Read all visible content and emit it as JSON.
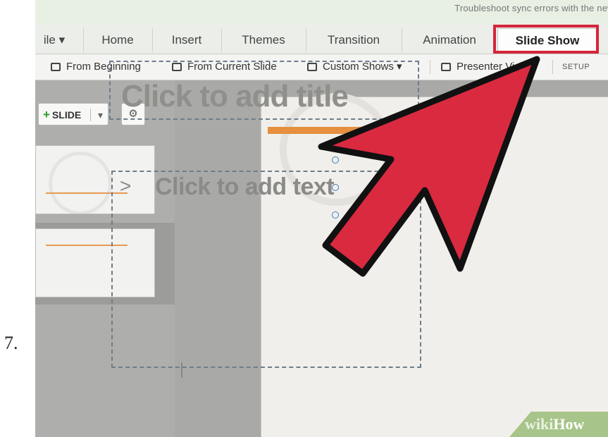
{
  "step_number": "7.",
  "doc_title": "Troubleshoot sync errors with the new a",
  "tabs": [
    {
      "label": "ile ▾"
    },
    {
      "label": "Home"
    },
    {
      "label": "Insert"
    },
    {
      "label": "Themes"
    },
    {
      "label": "Transition"
    },
    {
      "label": "Animation"
    },
    {
      "label": "Slide Show"
    }
  ],
  "active_tab": "Slide Show",
  "toolbar": {
    "from_beginning": "From Beginning",
    "from_current_slide": "From Current Slide",
    "custom_shows": "Custom Shows ▾",
    "presenter_view": "Presenter View",
    "setup": "SETUP"
  },
  "sidebar": {
    "add_slide_label": "SLIDE",
    "add_slide_plus": "+",
    "add_slide_caret": "▾",
    "layout_icon": "⚙"
  },
  "slide": {
    "title_placeholder": "Click to add title",
    "body_bullet": ">",
    "body_placeholder": "Click to add text"
  },
  "watermark": {
    "wiki": "wiki",
    "how": "How"
  },
  "colors": {
    "highlight": "#d6253a",
    "arrow_fill": "#d92a40",
    "accent_orange": "#e58f3f",
    "frame_green": "#a7c48a"
  },
  "icons": [
    "from-beginning-icon",
    "from-current-slide-icon",
    "custom-shows-icon",
    "presenter-view-icon",
    "add-slide-plus-icon",
    "slide-layout-icon",
    "pointer-arrow-icon"
  ]
}
